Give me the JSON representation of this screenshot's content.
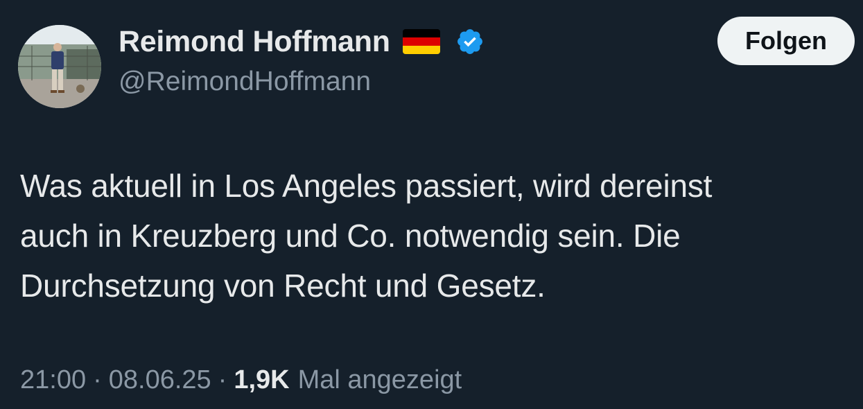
{
  "author": {
    "display_name": "Reimond Hoffmann",
    "handle": "@ReimondHoffmann",
    "flag_icon": "germany-flag-icon",
    "verified_icon": "verified-badge-icon",
    "verified_color": "#1d9bf0"
  },
  "follow_button": {
    "label": "Folgen"
  },
  "tweet": {
    "text_lines": [
      "Was aktuell in Los Angeles passiert, wird dereinst",
      "auch in Kreuzberg und Co. notwendig sein. Die",
      "Durchsetzung von Recht und Gesetz."
    ]
  },
  "meta": {
    "time": "21:00",
    "separator": "·",
    "date": "08.06.25",
    "views_count": "1,9K",
    "views_label": "Mal angezeigt"
  },
  "colors": {
    "background": "#15202b",
    "text_primary": "#e7e9ea",
    "text_secondary": "#8b98a5",
    "button_background": "#eff3f4"
  }
}
